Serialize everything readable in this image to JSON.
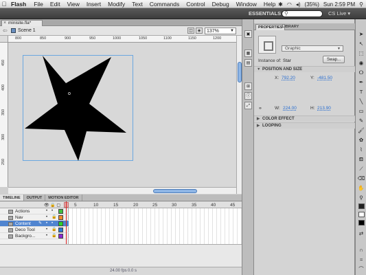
{
  "menubar": {
    "apple": "",
    "app_name": "Flash",
    "items": [
      "File",
      "Edit",
      "View",
      "Insert",
      "Modify",
      "Text",
      "Commands",
      "Control",
      "Debug",
      "Window",
      "Help"
    ],
    "battery": "(35%)",
    "clock": "Sun 2:59 PM"
  },
  "appbar": {
    "workspace": "ESSENTIALS ▾",
    "cs_live": "CS Live ▾"
  },
  "document": {
    "tab_name": "minisite.fla*",
    "close_glyph": "×",
    "scene": "Scene 1",
    "zoom": "137%"
  },
  "rulers": {
    "h": [
      "800",
      "850",
      "900",
      "950",
      "1000",
      "1050",
      "1100",
      "1150",
      "1200"
    ],
    "v": [
      "450",
      "400",
      "350",
      "300",
      "250"
    ]
  },
  "stage": {
    "shape": "star",
    "fill": "#000000",
    "registration_point": "o"
  },
  "timeline": {
    "tabs": [
      "TIMELINE",
      "OUTPUT",
      "MOTION EDITOR"
    ],
    "frame_numbers": [
      "5",
      "10",
      "15",
      "20",
      "25",
      "30",
      "35",
      "40",
      "45",
      "50",
      "55",
      "6"
    ],
    "layers": [
      {
        "name": "Actions",
        "color": "#3fbf3f",
        "selected": false
      },
      {
        "name": "Nav",
        "color": "#ef8a2a",
        "selected": false
      },
      {
        "name": "Content",
        "color": "#2ad12a",
        "selected": true
      },
      {
        "name": "Deco Tool",
        "color": "#2a7ad1",
        "selected": false
      },
      {
        "name": "Backgro...",
        "color": "#8a2ad1",
        "selected": false
      }
    ],
    "fps": "24.00 fps",
    "seconds": "0.0 s"
  },
  "properties": {
    "tabs": [
      "PROPERTIES",
      "LIBRARY"
    ],
    "symbol_type": "Graphic",
    "instance_label": "Instance of:",
    "instance_value": "Star",
    "swap_label": "Swap...",
    "sections": {
      "position_size": "POSITION AND SIZE",
      "color_effect": "COLOR EFFECT",
      "looping": "LOOPING"
    },
    "x_label": "X:",
    "x_value": "792.20",
    "y_label": "Y:",
    "y_value": "-481.50",
    "w_label": "W:",
    "w_value": "224.00",
    "h_label": "H:",
    "h_value": "213.90"
  },
  "colors": {
    "accent_blue": "#4f84d0",
    "link_blue": "#2a6ed0",
    "stage_border": "#6aa7e0",
    "playhead": "#dd2222"
  }
}
